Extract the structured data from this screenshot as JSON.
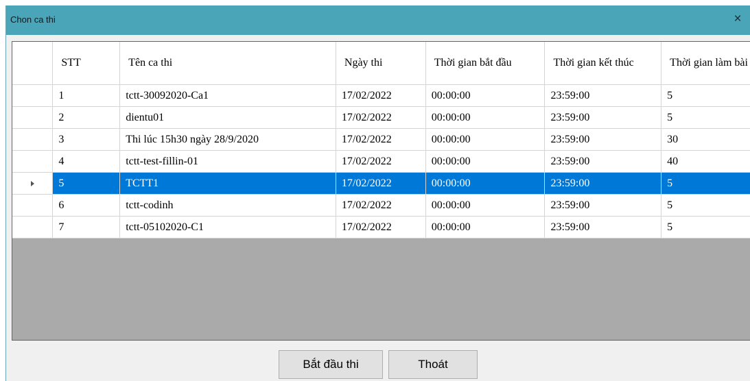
{
  "window": {
    "title": "Chon ca thi",
    "close_icon": "×"
  },
  "table": {
    "columns": [
      "STT",
      "Tên ca thi",
      "Ngày thi",
      "Thời gian bắt đầu",
      "Thời gian kết thúc",
      "Thời gian làm bài"
    ],
    "rows": [
      [
        "1",
        "tctt-30092020-Ca1",
        "17/02/2022",
        "00:00:00",
        "23:59:00",
        "5"
      ],
      [
        "2",
        "dientu01",
        "17/02/2022",
        "00:00:00",
        "23:59:00",
        "5"
      ],
      [
        "3",
        "Thi lúc 15h30 ngày 28/9/2020",
        "17/02/2022",
        "00:00:00",
        "23:59:00",
        "30"
      ],
      [
        "4",
        "tctt-test-fillin-01",
        "17/02/2022",
        "00:00:00",
        "23:59:00",
        "40"
      ],
      [
        "5",
        "TCTT1",
        "17/02/2022",
        "00:00:00",
        "23:59:00",
        "5"
      ],
      [
        "6",
        "tctt-codinh",
        "17/02/2022",
        "00:00:00",
        "23:59:00",
        "5"
      ],
      [
        "7",
        "tctt-05102020-C1",
        "17/02/2022",
        "00:00:00",
        "23:59:00",
        "5"
      ]
    ],
    "selected_index": 4
  },
  "buttons": {
    "start": "Bắt đầu thi",
    "exit": "Thoát"
  },
  "colors": {
    "titlebar": "#4aa5b8",
    "selection": "#0078d7",
    "grid_background": "#aaaaaa"
  }
}
